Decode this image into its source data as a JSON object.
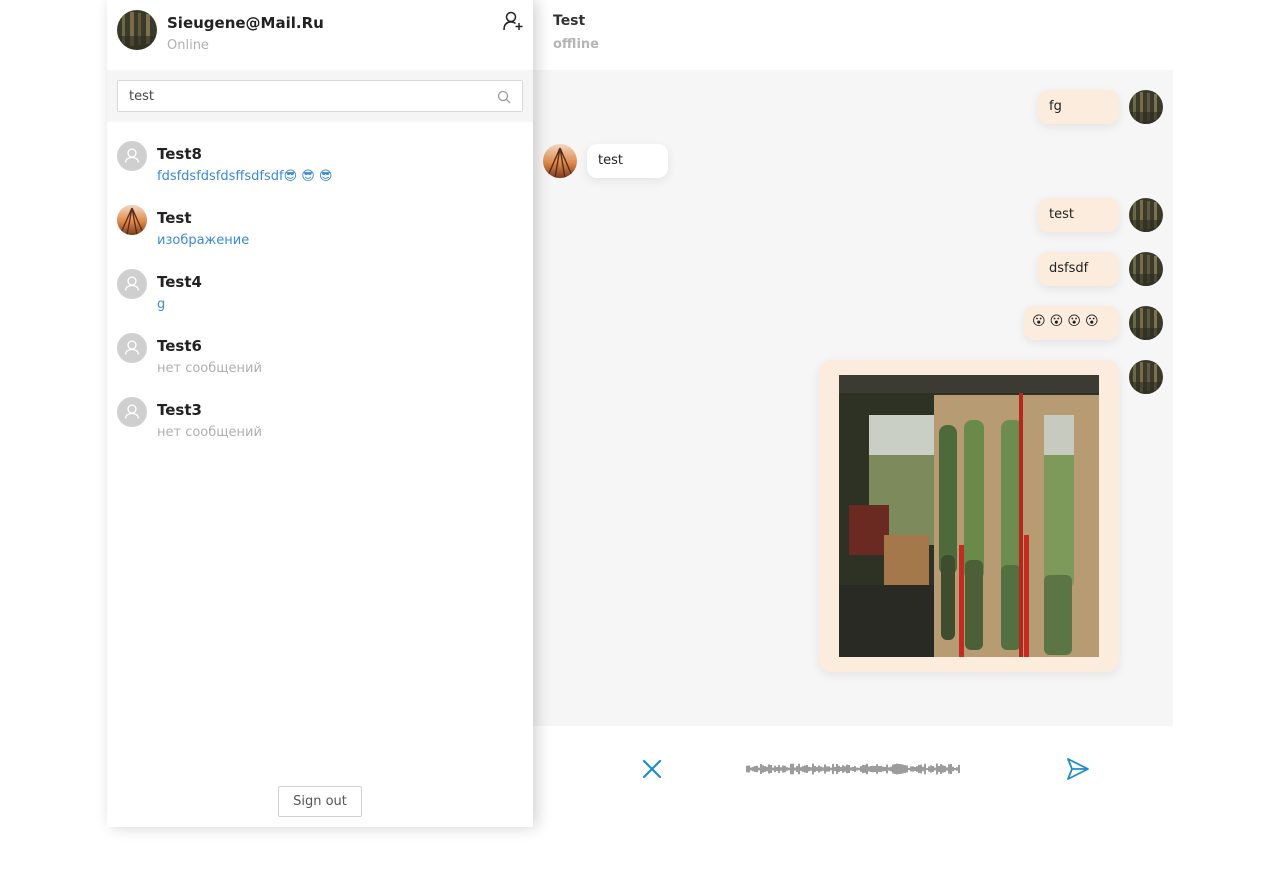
{
  "profile": {
    "name": "Sieugene@Mail.Ru",
    "status": "Online",
    "add_contact_icon": "user-plus-icon"
  },
  "search": {
    "value": "test",
    "icon": "search-icon"
  },
  "contacts": [
    {
      "name": "Test8",
      "preview": "fdsfdsfdsfdsffsdfsdf😎 😎 😎",
      "preview_style": "blue",
      "avatar": "default"
    },
    {
      "name": "Test",
      "preview": "изображение",
      "preview_style": "blue",
      "avatar": "photo"
    },
    {
      "name": "Test4",
      "preview": "g",
      "preview_style": "blue",
      "avatar": "default"
    },
    {
      "name": "Test6",
      "preview": "нет сообщений",
      "preview_style": "grey",
      "avatar": "default"
    },
    {
      "name": "Test3",
      "preview": "нет сообщений",
      "preview_style": "grey",
      "avatar": "default"
    }
  ],
  "sign_out_label": "Sign out",
  "chat": {
    "title": "Test",
    "status": "offline"
  },
  "messages": [
    {
      "direction": "out",
      "text": "fg"
    },
    {
      "direction": "in",
      "text": "test"
    },
    {
      "direction": "out",
      "text": "test"
    },
    {
      "direction": "out",
      "text": "dsfsdf"
    },
    {
      "direction": "out",
      "text": "😮 😮 😮 😮"
    },
    {
      "direction": "out",
      "type": "image"
    }
  ],
  "composer": {
    "cancel_icon": "close-icon",
    "waveform": "audio-waveform",
    "send_icon": "send-icon"
  },
  "colors": {
    "accent": "#1e8fc6",
    "link": "#3a8ad6",
    "outgoing_bubble": "#fbecdd",
    "chat_bg": "#f6f6f6"
  }
}
